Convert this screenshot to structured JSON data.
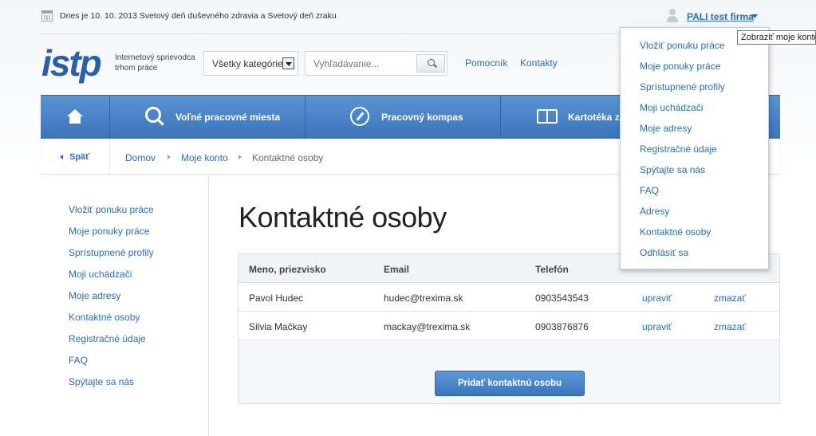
{
  "topbar": {
    "today": "Dnes je 10. 10. 2013 Svetový deň duševného zdravia a Svetový deň zraku",
    "user": "PALI test firma",
    "tooltip": "Zobraziť moje konto"
  },
  "header": {
    "logo": "istp",
    "tagline_line1": "Internetový sprievodca",
    "tagline_line2": "trhom práce",
    "category_select": "Všetky kategórie",
    "search_placeholder": "Vyhľadávanie...",
    "links": [
      "Pomocník",
      "Kontakty"
    ]
  },
  "nav": {
    "items": [
      {
        "label": "",
        "icon": "home-icon"
      },
      {
        "label": "Voľné pracovné miesta",
        "icon": "search-icon"
      },
      {
        "label": "Pracovný kompas",
        "icon": "compass-icon"
      },
      {
        "label": "Kartotéka za",
        "icon": "book-icon"
      }
    ]
  },
  "breadcrumb": {
    "back": "Späť",
    "items": [
      "Domov",
      "Moje konto",
      "Kontaktné osoby"
    ]
  },
  "sidebar": {
    "items": [
      "Vložiť ponuku práce",
      "Moje ponuky práce",
      "Sprístupnené profily",
      "Moji uchádzači",
      "Moje adresy",
      "Kontaktné osoby",
      "Registračné údaje",
      "FAQ",
      "Spýtajte sa nás"
    ]
  },
  "main": {
    "title": "Kontaktné osoby",
    "table": {
      "headers": [
        "Meno, priezvisko",
        "Email",
        "Telefón"
      ],
      "rows": [
        {
          "name": "Pavol Hudec",
          "email": "hudec@trexima.sk",
          "phone": "0903543543",
          "edit": "upraviť",
          "delete": "zmazať"
        },
        {
          "name": "Silvia Mačkay",
          "email": "mackay@trexima.sk",
          "phone": "0903876876",
          "edit": "upraviť",
          "delete": "zmazať"
        }
      ]
    },
    "add_button": "Pridať kontaktnú osobu"
  },
  "dropdown": {
    "items": [
      "Vložiť ponuku práce",
      "Moje ponuky práce",
      "Sprístupnené profily",
      "Moji uchádzači",
      "Moje adresy",
      "Registračné údaje",
      "Spýtajte sa nás",
      "FAQ",
      "Adresy",
      "Kontaktné osoby",
      "Odhlásiť sa"
    ]
  },
  "colors": {
    "link": "#2a6db5",
    "nav_top": "#5b93d1",
    "nav_bottom": "#3a74ba",
    "logo": "#2b5fa8"
  }
}
